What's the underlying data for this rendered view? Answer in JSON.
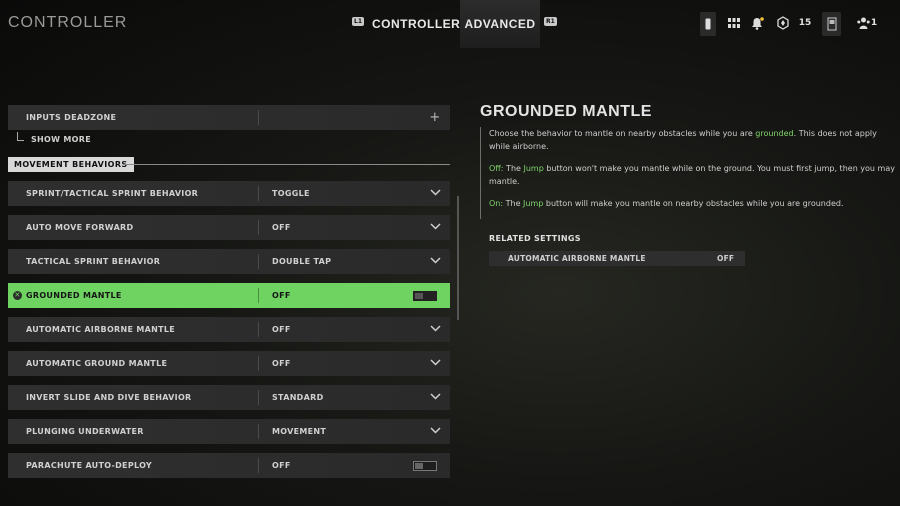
{
  "header": {
    "title": "CONTROLLER",
    "tabs": [
      {
        "hint": "L1",
        "label": "CONTROLLER"
      },
      {
        "hint": "R1",
        "label": "ADVANCED"
      }
    ],
    "notification_count": "15",
    "party_count": "1",
    "icons": [
      "controller-icon",
      "grid-menu-icon",
      "notification-bell-icon",
      "rank-badge-icon",
      "player-card-icon",
      "party-icon"
    ]
  },
  "inputs_deadzone": {
    "label": "INPUTS DEADZONE",
    "action_icon": "plus-icon"
  },
  "show_more": "SHOW MORE",
  "section": "MOVEMENT BEHAVIORS",
  "settings": [
    {
      "label": "SPRINT/TACTICAL SPRINT BEHAVIOR",
      "value": "TOGGLE",
      "control": "dropdown"
    },
    {
      "label": "AUTO MOVE FORWARD",
      "value": "OFF",
      "control": "dropdown"
    },
    {
      "label": "TACTICAL SPRINT BEHAVIOR",
      "value": "DOUBLE TAP",
      "control": "dropdown"
    },
    {
      "label": "GROUNDED MANTLE",
      "value": "OFF",
      "control": "toggle",
      "selected": true
    },
    {
      "label": "AUTOMATIC AIRBORNE MANTLE",
      "value": "OFF",
      "control": "dropdown"
    },
    {
      "label": "AUTOMATIC GROUND MANTLE",
      "value": "OFF",
      "control": "dropdown"
    },
    {
      "label": "INVERT SLIDE AND DIVE BEHAVIOR",
      "value": "STANDARD",
      "control": "dropdown"
    },
    {
      "label": "PLUNGING UNDERWATER",
      "value": "MOVEMENT",
      "control": "dropdown"
    },
    {
      "label": "PARACHUTE AUTO-DEPLOY",
      "value": "OFF",
      "control": "toggle"
    }
  ],
  "detail": {
    "title": "GROUNDED MANTLE",
    "desc_pre": "Choose the behavior to mantle on nearby obstacles while you are ",
    "desc_hl": "grounded",
    "desc_post": ". This does not apply while airborne.",
    "off_label": "Off:",
    "off_pre": " The ",
    "off_jump": "Jump",
    "off_post": " button won't make you mantle while on the ground. You must first jump, then you may mantle.",
    "on_label": "On:",
    "on_pre": " The ",
    "on_jump": "Jump",
    "on_post": " button will make you mantle on nearby obstacles while you are grounded."
  },
  "related": {
    "title": "RELATED SETTINGS",
    "items": [
      {
        "label": "AUTOMATIC AIRBORNE MANTLE",
        "value": "OFF"
      }
    ]
  },
  "colors": {
    "accent": "#6fd362",
    "highlight_text": "#7fd66a"
  }
}
